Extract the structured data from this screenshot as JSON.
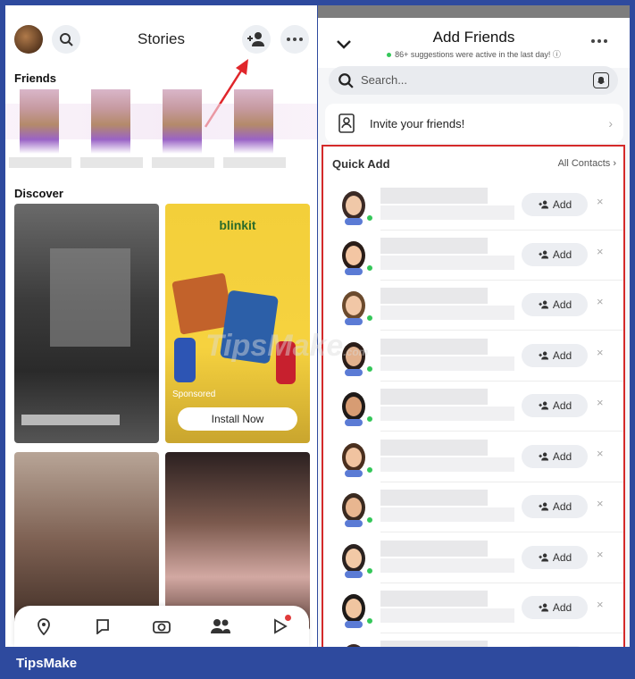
{
  "left": {
    "title": "Stories",
    "friends_label": "Friends",
    "discover_label": "Discover",
    "ad": {
      "brand": "blinkit",
      "sponsored": "Sponsored",
      "cta": "Install Now"
    }
  },
  "right": {
    "title": "Add Friends",
    "subtitle": "86+ suggestions were active in the last day!",
    "search_placeholder": "Search...",
    "invite_label": "Invite your friends!",
    "quick_add_label": "Quick Add",
    "all_contacts_label": "All Contacts",
    "add_label": "Add",
    "dismiss": "×"
  },
  "footer": {
    "brand": "TipsMake"
  },
  "watermark": "TipsMake",
  "colors": {
    "accent_red": "#d42a2a",
    "online_green": "#34c759",
    "brand_blue": "#2e4a9e"
  }
}
